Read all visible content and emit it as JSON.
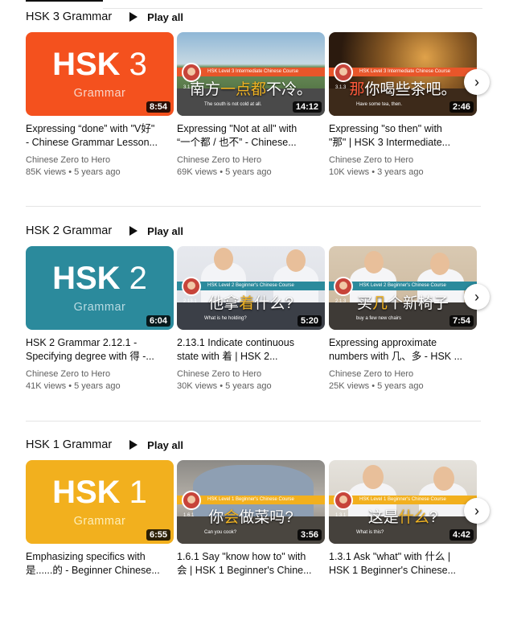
{
  "shelves": [
    {
      "title": "HSK 3 Grammar",
      "play_all": "Play all",
      "videos": [
        {
          "kind": "tile",
          "tile_label": "HSK",
          "tile_number": "3",
          "tile_sub": "Grammar",
          "duration": "8:54",
          "title_line1": "Expressing “done” with \"V好\"",
          "title_line2": "- Chinese Grammar Lesson...",
          "channel": "Chinese Zero to Hero",
          "views": "85K views",
          "age": "5 years ago"
        },
        {
          "kind": "scene",
          "banner": "HSK Level 3 Intermediate Chinese Course",
          "lesson": "3.1.2",
          "zh_pre": "南方",
          "zh_hl": "一点都",
          "zh_post": "不冷。",
          "en": "The south is not cold at all.",
          "duration": "14:12",
          "title_line1": "Expressing \"Not at all\" with",
          "title_line2": "“一个都 / 也不” - Chinese...",
          "channel": "Chinese Zero to Hero",
          "views": "69K views",
          "age": "5 years ago"
        },
        {
          "kind": "scene",
          "banner": "HSK Level 3 Intermediate Chinese Course",
          "lesson": "3.1.3",
          "zh_pre": "",
          "zh_hl": "那",
          "zh_post": "你喝些茶吧。",
          "en": "Have some tea, then.",
          "duration": "2:46",
          "title_line1": "Expressing \"so then\" with",
          "title_line2": "\"那\" | HSK 3 Intermediate...",
          "channel": "Chinese Zero to Hero",
          "views": "10K views",
          "age": "3 years ago"
        }
      ]
    },
    {
      "title": "HSK 2 Grammar",
      "play_all": "Play all",
      "videos": [
        {
          "kind": "tile",
          "tile_label": "HSK",
          "tile_number": "2",
          "tile_sub": "Grammar",
          "duration": "6:04",
          "title_line1": "HSK 2 Grammar 2.12.1 -",
          "title_line2": "Specifying degree with 得 -...",
          "channel": "Chinese Zero to Hero",
          "views": "41K views",
          "age": "5 years ago"
        },
        {
          "kind": "scene",
          "banner": "HSK Level 2 Beginner's Chinese Course",
          "lesson": "2.13.1",
          "zh_pre": "他拿",
          "zh_hl": "着",
          "zh_post": "什么?",
          "en": "What is he holding?",
          "duration": "5:20",
          "title_line1": "2.13.1 Indicate continuous",
          "title_line2": "state with 着 | HSK 2...",
          "channel": "Chinese Zero to Hero",
          "views": "30K views",
          "age": "5 years ago"
        },
        {
          "kind": "scene",
          "banner": "HSK Level 2 Beginner's Chinese Course",
          "lesson": "2.1.3",
          "zh_pre": "买",
          "zh_hl": "几",
          "zh_post": "个新椅子",
          "en": "buy a few new chairs",
          "duration": "7:54",
          "title_line1": "Expressing approximate",
          "title_line2": "numbers with 几、多 - HSK ...",
          "channel": "Chinese Zero to Hero",
          "views": "25K views",
          "age": "5 years ago"
        }
      ]
    },
    {
      "title": "HSK 1 Grammar",
      "play_all": "Play all",
      "videos": [
        {
          "kind": "tile",
          "tile_label": "HSK",
          "tile_number": "1",
          "tile_sub": "Grammar",
          "duration": "6:55",
          "title_line1": "Emphasizing specifics with",
          "title_line2": "是......的 - Beginner Chinese...",
          "channel": "",
          "views": "",
          "age": ""
        },
        {
          "kind": "scene",
          "banner": "HSK Level 1 Beginner's Chinese Course",
          "lesson": "1.6.1",
          "zh_pre": "你",
          "zh_hl": "会",
          "zh_post": "做菜吗?",
          "en": "Can you cook?",
          "duration": "3:56",
          "title_line1": "1.6.1 Say \"know how to\" with",
          "title_line2": "会 | HSK 1 Beginner's Chine...",
          "channel": "",
          "views": "",
          "age": ""
        },
        {
          "kind": "scene",
          "banner": "HSK Level 1 Beginner's Chinese Course",
          "lesson": "1.3.1",
          "zh_pre": "这是",
          "zh_hl": "什么",
          "zh_post": "?",
          "en": "What is this?",
          "duration": "4:42",
          "title_line1": "1.3.1 Ask \"what\" with 什么 |",
          "title_line2": "HSK 1 Beginner's Chinese...",
          "channel": "",
          "views": "",
          "age": ""
        }
      ]
    }
  ],
  "next_icon": "chevron-right-icon",
  "colors": {
    "hsk3": "#f4511e",
    "hsk2": "#2b8a9c",
    "hsk1": "#f2b01e",
    "hsk3_sub": "#f8d5c8",
    "hsk2_sub": "#b9dbe2",
    "hsk1_sub": "#fdeeb8"
  }
}
